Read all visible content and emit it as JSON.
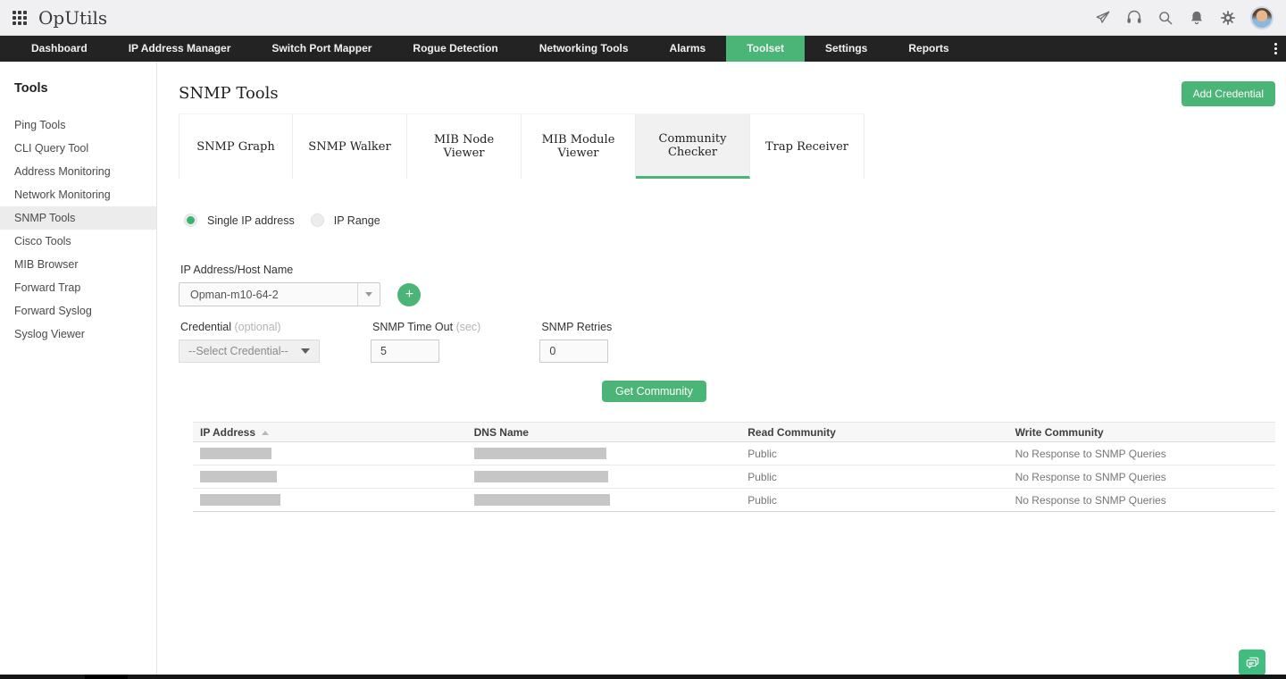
{
  "app": {
    "name": "OpUtils"
  },
  "topbar": {
    "icons": [
      "grid-launcher-icon",
      "rocket-icon",
      "headset-icon",
      "search-icon",
      "bell-icon",
      "gear-icon",
      "avatar"
    ]
  },
  "nav": {
    "items": [
      {
        "label": "Dashboard",
        "active": false
      },
      {
        "label": "IP Address Manager",
        "active": false
      },
      {
        "label": "Switch Port Mapper",
        "active": false
      },
      {
        "label": "Rogue Detection",
        "active": false
      },
      {
        "label": "Networking Tools",
        "active": false
      },
      {
        "label": "Alarms",
        "active": false
      },
      {
        "label": "Toolset",
        "active": true
      },
      {
        "label": "Settings",
        "active": false
      },
      {
        "label": "Reports",
        "active": false
      }
    ],
    "overflow_icon": "kebab-menu-icon"
  },
  "sidebar": {
    "title": "Tools",
    "items": [
      {
        "label": "Ping Tools",
        "active": false
      },
      {
        "label": "CLI Query Tool",
        "active": false
      },
      {
        "label": "Address Monitoring",
        "active": false
      },
      {
        "label": "Network Monitoring",
        "active": false
      },
      {
        "label": "SNMP Tools",
        "active": true
      },
      {
        "label": "Cisco Tools",
        "active": false
      },
      {
        "label": "MIB Browser",
        "active": false
      },
      {
        "label": "Forward Trap",
        "active": false
      },
      {
        "label": "Forward Syslog",
        "active": false
      },
      {
        "label": "Syslog Viewer",
        "active": false
      }
    ]
  },
  "main": {
    "title": "SNMP Tools",
    "add_credential_label": "Add Credential",
    "tabs": [
      {
        "label": "SNMP Graph",
        "active": false
      },
      {
        "label": "SNMP Walker",
        "active": false
      },
      {
        "label": "MIB Node Viewer",
        "active": false
      },
      {
        "label": "MIB Module Viewer",
        "active": false
      },
      {
        "label": "Community Checker",
        "active": true
      },
      {
        "label": "Trap Receiver",
        "active": false
      }
    ],
    "radios": [
      {
        "label": "Single IP address",
        "selected": true
      },
      {
        "label": "IP Range",
        "selected": false
      }
    ],
    "form": {
      "ip_label": "IP Address/Host Name",
      "ip_value": "Opman-m10-64-2",
      "add_ip_icon": "plus-icon",
      "credential_label": "Credential",
      "credential_optional": "(optional)",
      "credential_value": "--Select Credential--",
      "timeout_label": "SNMP Time Out",
      "timeout_unit": "(sec)",
      "timeout_value": "5",
      "retries_label": "SNMP Retries",
      "retries_value": "0",
      "submit_label": "Get Community"
    },
    "table": {
      "columns": [
        "IP Address",
        "DNS Name",
        "Read Community",
        "Write Community"
      ],
      "sort_icon": "sort-asc-icon",
      "rows": [
        {
          "ip_redacted": true,
          "dns_redacted": true,
          "read_community": "Public",
          "write_community": "No Response to SNMP Queries"
        },
        {
          "ip_redacted": true,
          "dns_redacted": true,
          "read_community": "Public",
          "write_community": "No Response to SNMP Queries"
        },
        {
          "ip_redacted": true,
          "dns_redacted": true,
          "read_community": "Public",
          "write_community": "No Response to SNMP Queries"
        }
      ]
    }
  },
  "footer": {
    "chat_icon": "chat-bubbles-icon"
  },
  "colors": {
    "accent_green": "#4bb578",
    "nav_bg": "#232323",
    "topbar_bg": "#f0f0f2",
    "active_sidebar_bg": "#ececec",
    "redaction_gray": "#c6c6c6"
  }
}
